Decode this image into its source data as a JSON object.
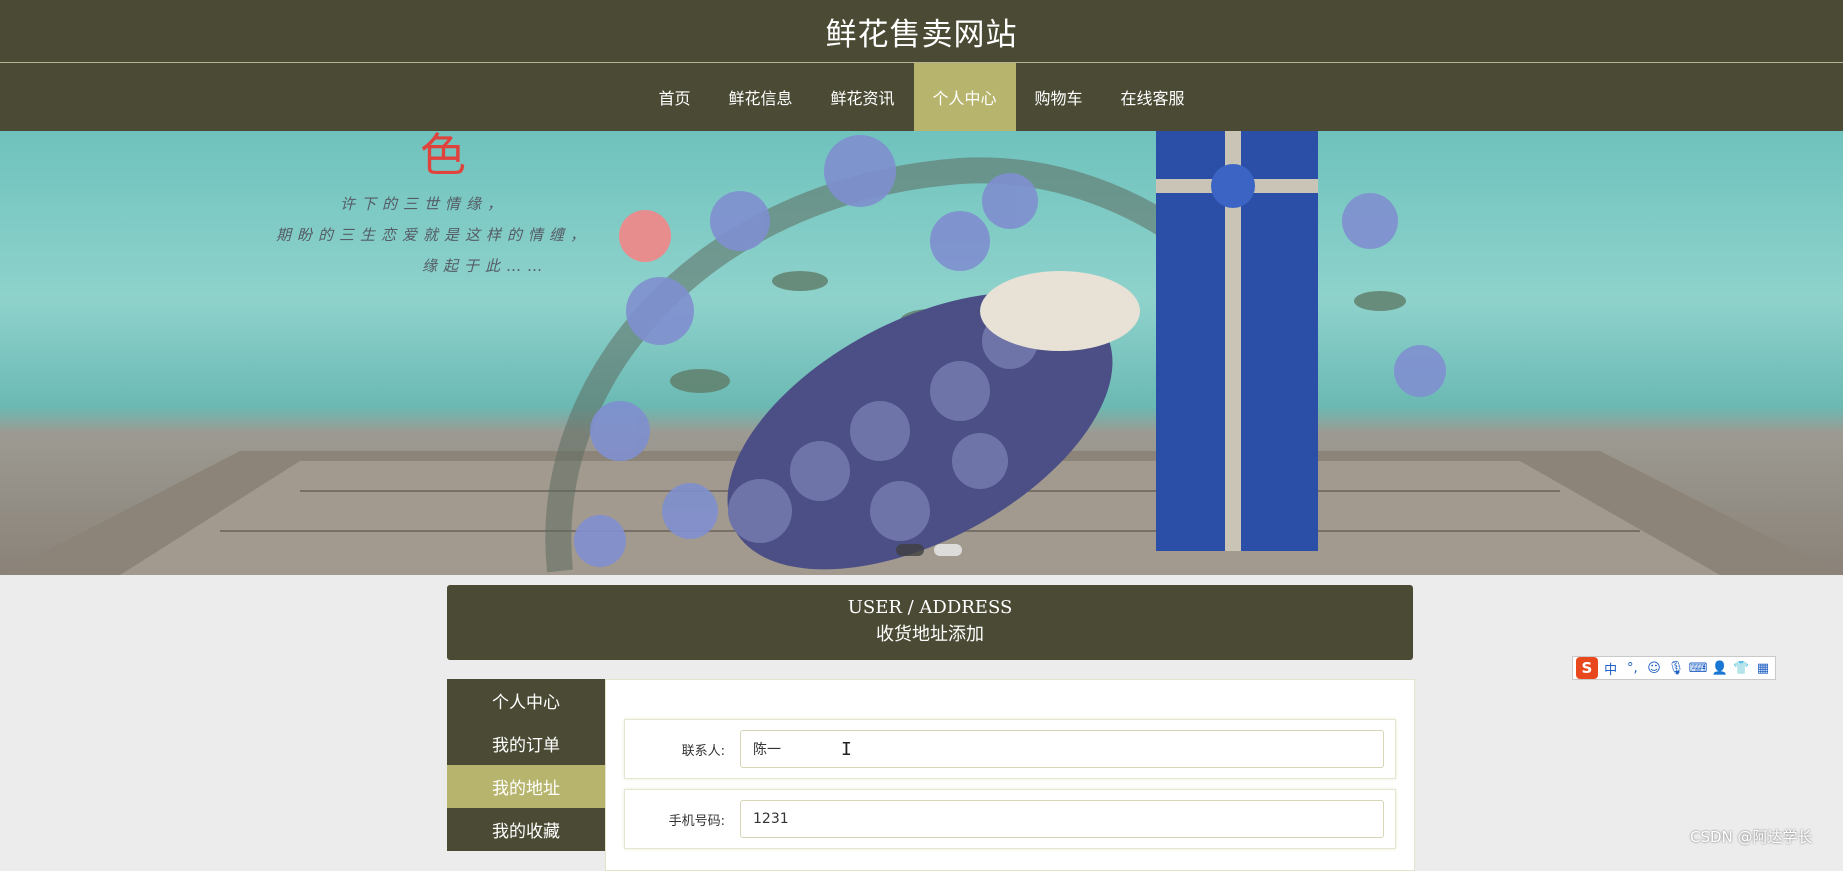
{
  "site": {
    "title": "鲜花售卖网站"
  },
  "nav": {
    "items": [
      {
        "label": "首页"
      },
      {
        "label": "鲜花信息"
      },
      {
        "label": "鲜花资讯"
      },
      {
        "label": "个人中心",
        "active": true
      },
      {
        "label": "购物车"
      },
      {
        "label": "在线客服"
      }
    ]
  },
  "banner": {
    "title_fragment": "色",
    "poem": [
      "许下的三世情缘，",
      "期盼的三生恋爱就是这样的情缠，",
      "缘起于此……"
    ],
    "slide_count": 2
  },
  "section": {
    "title_en": "USER / ADDRESS",
    "title_cn": "收货地址添加"
  },
  "side_menu": {
    "items": [
      {
        "label": "个人中心"
      },
      {
        "label": "我的订单"
      },
      {
        "label": "我的地址",
        "active": true
      },
      {
        "label": "我的收藏"
      }
    ]
  },
  "form": {
    "contact": {
      "label": "联系人:",
      "value": "陈一"
    },
    "phone": {
      "label": "手机号码:",
      "value": "1231"
    }
  },
  "ime": {
    "logo": "S",
    "mode": "中",
    "icons": [
      "punctuation-icon",
      "emoji-icon",
      "microphone-icon",
      "keyboard-icon",
      "user-icon",
      "shirt-icon",
      "grid-icon"
    ]
  },
  "watermark": "CSDN @阿达学长",
  "colors": {
    "primary": "#4b4b35",
    "accent": "#b7b56d",
    "background": "#ececec"
  }
}
